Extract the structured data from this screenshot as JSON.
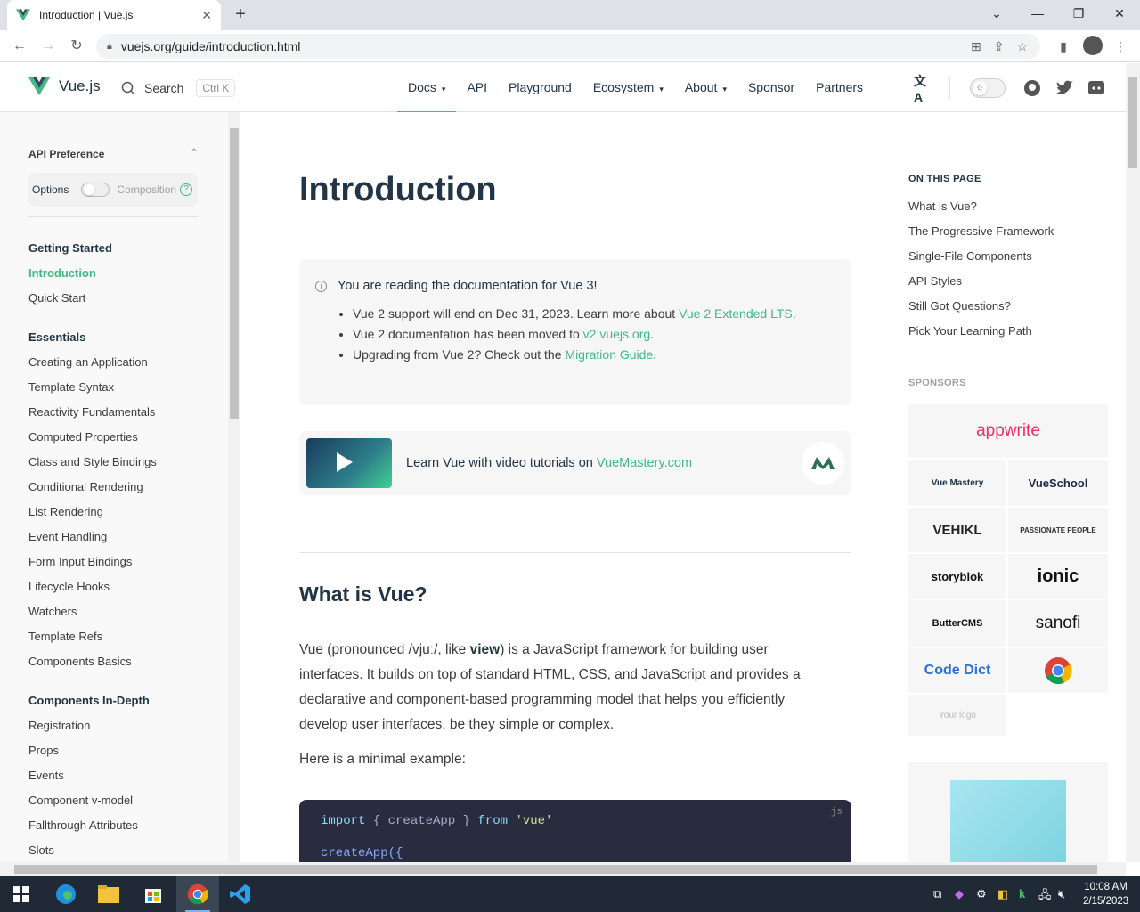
{
  "browser": {
    "tab_title": "Introduction | Vue.js",
    "url": "vuejs.org/guide/introduction.html"
  },
  "header": {
    "logo_text": "Vue.js",
    "search_label": "Search",
    "search_shortcut": "Ctrl K",
    "nav": [
      "Docs",
      "API",
      "Playground",
      "Ecosystem",
      "About",
      "Sponsor",
      "Partners"
    ]
  },
  "sidebar": {
    "api_pref_title": "API Preference",
    "options_label": "Options",
    "composition_label": "Composition",
    "sections": [
      {
        "title": "Getting Started",
        "items": [
          "Introduction",
          "Quick Start"
        ]
      },
      {
        "title": "Essentials",
        "items": [
          "Creating an Application",
          "Template Syntax",
          "Reactivity Fundamentals",
          "Computed Properties",
          "Class and Style Bindings",
          "Conditional Rendering",
          "List Rendering",
          "Event Handling",
          "Form Input Bindings",
          "Lifecycle Hooks",
          "Watchers",
          "Template Refs",
          "Components Basics"
        ]
      },
      {
        "title": "Components In-Depth",
        "items": [
          "Registration",
          "Props",
          "Events",
          "Component v-model",
          "Fallthrough Attributes",
          "Slots"
        ]
      }
    ]
  },
  "main": {
    "title": "Introduction",
    "callout_title": "You are reading the documentation for Vue 3!",
    "callout_1a": "Vue 2 support will end on Dec 31, 2023. Learn more about ",
    "callout_1_link": "Vue 2 Extended LTS",
    "callout_2a": "Vue 2 documentation has been moved to ",
    "callout_2_link": "v2.vuejs.org",
    "callout_3a": "Upgrading from Vue 2? Check out the ",
    "callout_3_link": "Migration Guide",
    "vm_text": "Learn Vue with video tutorials on ",
    "vm_link": "VueMastery.com",
    "h2": "What is Vue?",
    "para_a": "Vue (pronounced /vjuː/, like ",
    "para_bold": "view",
    "para_b": ") is a JavaScript framework for building user interfaces. It builds on top of standard HTML, CSS, and JavaScript and provides a declarative and component-based programming model that helps you efficiently develop user interfaces, be they simple or complex.",
    "para2": "Here is a minimal example:",
    "code_lang": "js",
    "code_l1_kw1": "import",
    "code_l1_mid": " { createApp } ",
    "code_l1_kw2": "from",
    "code_l1_str": " 'vue'",
    "code_l2": "createApp({"
  },
  "aside": {
    "on_this_page": "ON THIS PAGE",
    "items": [
      "What is Vue?",
      "The Progressive Framework",
      "Single-File Components",
      "API Styles",
      "Still Got Questions?",
      "Pick Your Learning Path"
    ],
    "sponsors": "SPONSORS",
    "sponsor_names": [
      "appwrite",
      "Vue Mastery",
      "VueSchool",
      "VEHIKL",
      "PASSIONATE PEOPLE",
      "storyblok",
      "ionic",
      "ButterCMS",
      "sanofi",
      "Code Dict",
      "Your logo"
    ]
  },
  "taskbar": {
    "time": "10:08 AM",
    "date": "2/15/2023"
  },
  "colors": {
    "accent": "#42b883",
    "text": "#213547"
  }
}
